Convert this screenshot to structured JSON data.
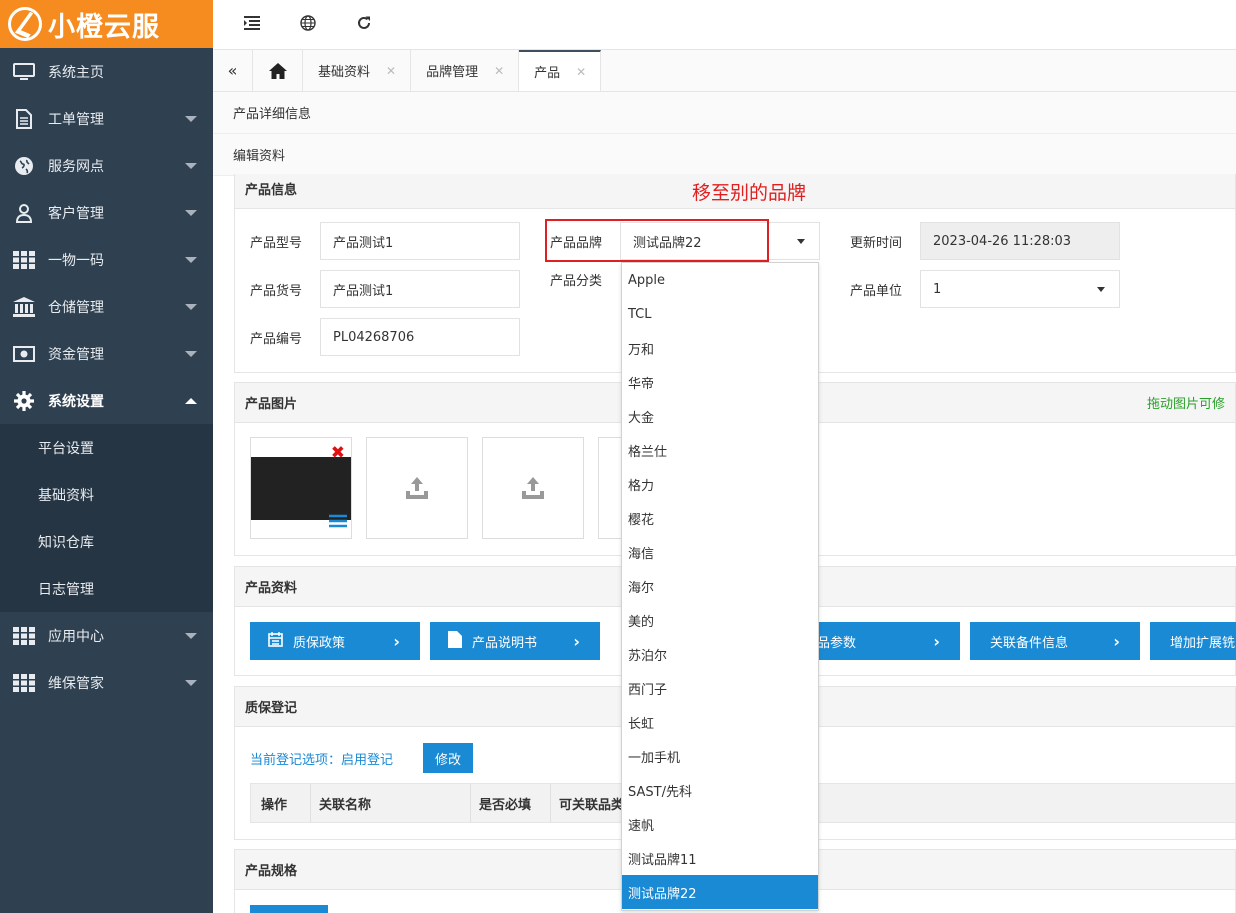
{
  "app": {
    "logo_text": "小橙云服"
  },
  "sidebar": {
    "items": [
      {
        "label": "系统主页",
        "icon": "monitor-icon"
      },
      {
        "label": "工单管理",
        "icon": "document-icon"
      },
      {
        "label": "服务网点",
        "icon": "globe-icon"
      },
      {
        "label": "客户管理",
        "icon": "user-icon"
      },
      {
        "label": "一物一码",
        "icon": "grid-icon"
      },
      {
        "label": "仓储管理",
        "icon": "bank-icon"
      },
      {
        "label": "资金管理",
        "icon": "money-icon"
      },
      {
        "label": "系统设置",
        "icon": "gear-icon"
      }
    ],
    "submenu": [
      "平台设置",
      "基础资料",
      "知识仓库",
      "日志管理"
    ],
    "bottom_items": [
      {
        "label": "应用中心",
        "icon": "grid-icon"
      },
      {
        "label": "维保管家",
        "icon": "grid-icon"
      }
    ]
  },
  "tabs": [
    {
      "label": "基础资料"
    },
    {
      "label": "品牌管理"
    },
    {
      "label": "产品"
    }
  ],
  "page": {
    "detail_title": "产品详细信息",
    "edit_title": "编辑资料"
  },
  "annotation": "移至别的品牌",
  "product_info": {
    "title": "产品信息",
    "model_label": "产品型号",
    "model_value": "产品测试1",
    "sku_label": "产品货号",
    "sku_value": "产品测试1",
    "code_label": "产品编号",
    "code_value": "PL04268706",
    "brand_label": "产品品牌",
    "brand_value": "测试品牌22",
    "category_label": "产品分类",
    "updated_label": "更新时间",
    "updated_value": "2023-04-26 11:28:03",
    "unit_label": "产品单位",
    "unit_value": "1"
  },
  "images": {
    "title": "产品图片",
    "hint": "拖动图片可修"
  },
  "materials": {
    "title": "产品资料",
    "buttons": [
      "质保政策",
      "产品说明书",
      "编辑产品参数",
      "关联备件信息",
      "增加扩展铣"
    ]
  },
  "warranty": {
    "title": "质保登记",
    "current_label": "当前登记选项：启用登记",
    "modify_button": "修改",
    "columns": [
      "操作",
      "关联名称",
      "是否必填",
      "可关联品类"
    ]
  },
  "specs": {
    "title": "产品规格"
  },
  "dropdown": {
    "options": [
      "Apple",
      "TCL",
      "万和",
      "华帝",
      "大金",
      "格兰仕",
      "格力",
      "樱花",
      "海信",
      "海尔",
      "美的",
      "苏泊尔",
      "西门子",
      "长虹",
      "一加手机",
      "SAST/先科",
      "速帆",
      "测试品牌11",
      "测试品牌22"
    ],
    "selected": "测试品牌22"
  },
  "colors": {
    "accent": "#1a8ad4",
    "logo_bg": "#f68c1f",
    "sidebar_bg": "#2f4050",
    "annotation": "#e02020"
  }
}
